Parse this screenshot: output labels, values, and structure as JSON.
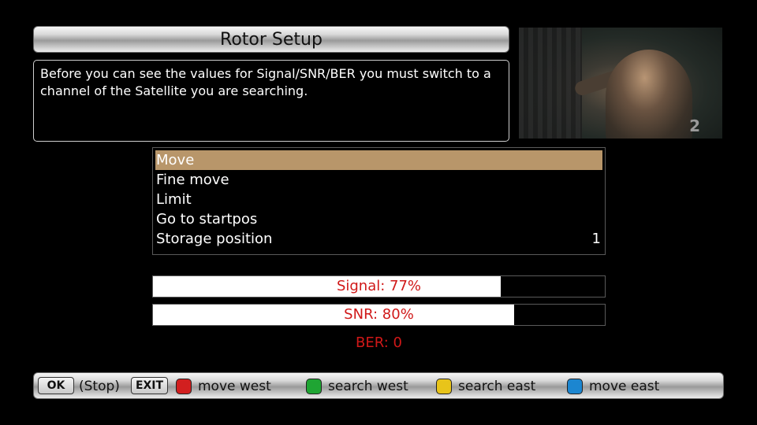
{
  "header": {
    "title": "Rotor Setup"
  },
  "info": {
    "text": "Before you can see the values for Signal/SNR/BER you must switch to a channel of the Satellite you are searching."
  },
  "pip": {
    "channel_number": "2"
  },
  "menu": {
    "items": [
      {
        "label": "Move",
        "value": "",
        "selected": true
      },
      {
        "label": "Fine move",
        "value": ""
      },
      {
        "label": "Limit",
        "value": ""
      },
      {
        "label": "Go to startpos",
        "value": ""
      },
      {
        "label": "Storage position",
        "value": "1"
      }
    ]
  },
  "signal": {
    "label": "Signal: 77%",
    "percent": 77
  },
  "snr": {
    "label": "SNR: 80%",
    "percent": 80
  },
  "ber": {
    "label": "BER: 0"
  },
  "footer": {
    "ok_key": "OK",
    "ok_text": "(Stop)",
    "exit_key": "EXIT",
    "red": {
      "label": "move west",
      "color": "#d21f1f"
    },
    "green": {
      "label": "search west",
      "color": "#1fa533"
    },
    "yellow": {
      "label": "search east",
      "color": "#e8c41a"
    },
    "blue": {
      "label": "move east",
      "color": "#1c86d0"
    }
  }
}
